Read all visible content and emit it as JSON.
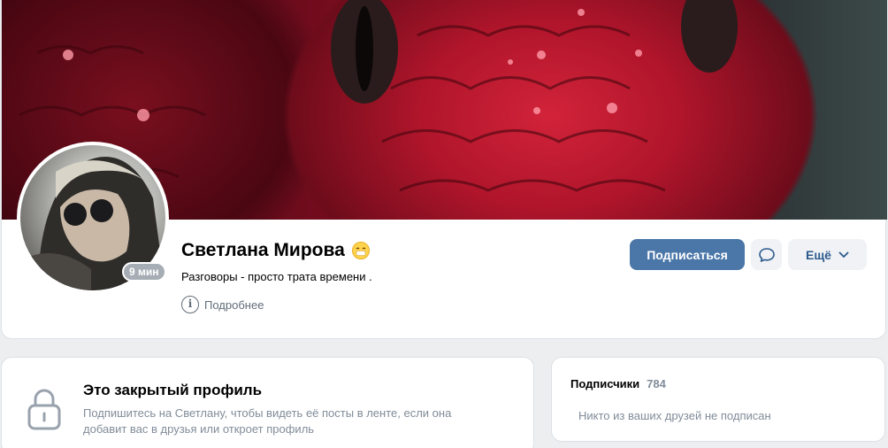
{
  "profile": {
    "name": "Светлана Мирова",
    "status": "Разговоры - просто трата времени .",
    "details_label": "Подробнее",
    "online_badge": "9 мин",
    "status_emoji": "smiling-emoji-icon"
  },
  "actions": {
    "subscribe_label": "Подписаться",
    "more_label": "Ещё",
    "message_icon": "message-bubble-icon"
  },
  "closed_profile": {
    "title": "Это закрытый профиль",
    "text": "Подпишитесь на Светлану, чтобы видеть её посты в ленте, если она добавит вас в друзья или откроет профиль",
    "icon": "lock-icon"
  },
  "subscribers": {
    "title": "Подписчики",
    "count": "784",
    "empty_text": "Никто из ваших друзей не подписан"
  },
  "colors": {
    "accent": "#4a76a8",
    "background": "#edeef0",
    "secondary_text": "#818c99"
  }
}
